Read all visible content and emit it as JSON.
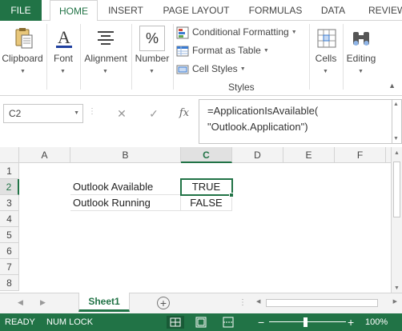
{
  "ribbon_tabs": [
    {
      "label": "FILE"
    },
    {
      "label": "HOME"
    },
    {
      "label": "INSERT"
    },
    {
      "label": "PAGE LAYOUT"
    },
    {
      "label": "FORMULAS"
    },
    {
      "label": "DATA"
    },
    {
      "label": "REVIEW"
    }
  ],
  "ribbon": {
    "clipboard": "Clipboard",
    "font": "Font",
    "alignment": "Alignment",
    "number": "Number",
    "conditional_formatting": "Conditional Formatting",
    "format_as_table": "Format as Table",
    "cell_styles": "Cell Styles",
    "styles_group": "Styles",
    "cells": "Cells",
    "editing": "Editing",
    "number_glyph": "%"
  },
  "formula_bar": {
    "name_box": "C2",
    "cancel_glyph": "✕",
    "enter_glyph": "✓",
    "function_glyph": "fx",
    "formula_line1": "=ApplicationIsAvailable(",
    "formula_line2": "\"Outlook.Application\")"
  },
  "grid": {
    "columns": [
      "A",
      "B",
      "C",
      "D",
      "E",
      "F"
    ],
    "selected_column": "C",
    "rows": [
      "1",
      "2",
      "3",
      "4",
      "5",
      "6",
      "7",
      "8"
    ],
    "selected_row": "2",
    "cells": {
      "B2": "Outlook Available",
      "C2": "TRUE",
      "B3": "Outlook Running",
      "C3": "FALSE"
    }
  },
  "sheets": [
    {
      "label": "Sheet1"
    }
  ],
  "add_sheet_glyph": "+",
  "status": {
    "ready": "READY",
    "numlock": "NUM LOCK",
    "zoom_minus": "−",
    "zoom_plus": "+",
    "zoom_level": "100%"
  },
  "colors": {
    "accent": "#217346",
    "header_bg": "#f3f3f3",
    "gridline": "#e1e1e1"
  }
}
